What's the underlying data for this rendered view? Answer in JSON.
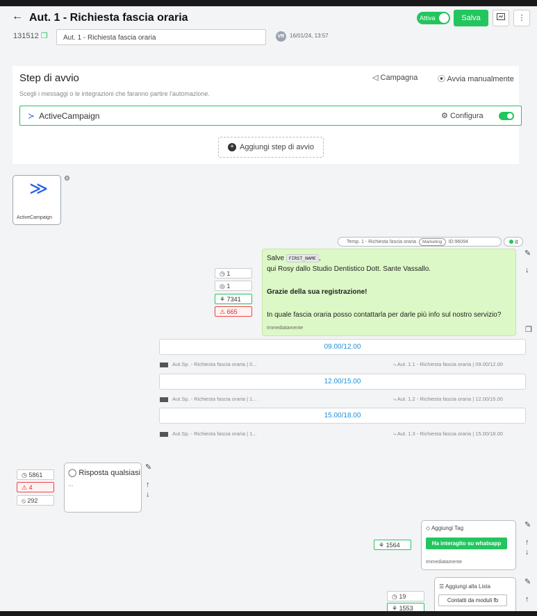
{
  "header": {
    "back_icon": "←",
    "title": "Aut. 1 - Richiesta fascia oraria",
    "active_label": "Attiva",
    "save_label": "Salva",
    "preview_icon": "preview-icon",
    "more_icon": "⋮",
    "auto_id": "131512",
    "name_value": "Aut. 1 - Richiesta fascia oraria",
    "user_initials": "VR",
    "datetime": "16/01/24, 13:57"
  },
  "start_step": {
    "title": "Step di avvio",
    "subtitle": "Scegli i messaggi o le integrazioni che faranno partire l'automazione.",
    "campaign_label": "Campagna",
    "manual_label": "Avvia manualmente",
    "trigger_name": "ActiveCampaign",
    "configure_label": "Configura",
    "add_step_label": "Aggiungi step di avvio"
  },
  "flow": {
    "trigger_node_label": "ActiveCampaign",
    "template": {
      "name": "Temp. 1 - Richiesta fascia oraria",
      "category": "Marketing",
      "id": "ID:96094",
      "lang": "it"
    },
    "message": {
      "greeting": "Salve",
      "variable": "FIRST_NAME",
      "greeting_end": ",",
      "line2": "qui Rosy dallo Studio Dentistico Dott. Sante Vassallo.",
      "line3": "Grazie della sua registrazione!",
      "line4": "In quale fascia oraria posso contattarla per darle più info sul nostro servizio?",
      "timing": "Immediatamente"
    },
    "message_stats": [
      "1",
      "1",
      "7341",
      "665"
    ],
    "options": [
      {
        "label": "09.00/12.00",
        "left": "Aut.Sp. - Richiesta fascia oraria | 0...",
        "right": "Aut. 1.1 - Richiesta fascia oraria | 09.00/12.00"
      },
      {
        "label": "12.00/15.00",
        "left": "Aut.Sp. - Richiesta fascia oraria | 1...",
        "right": "Aut. 1.2 - Richiesta fascia oraria | 12.00/15.00"
      },
      {
        "label": "15.00/18.00",
        "left": "Aut.Sp. - Richiesta fascia oraria | 1...",
        "right": "Aut. 1.3 - Richiesta fascia oraria | 15.00/18.00"
      }
    ],
    "response": {
      "label": "Risposta qualsiasi",
      "ellipsis": "...",
      "stats": [
        "5861",
        "4",
        "292"
      ]
    },
    "tag_step": {
      "title": "Aggiungi Tag",
      "tag": "Ha interagito su whatsapp",
      "timing": "Immediatamente",
      "stat": "1564"
    },
    "list_step": {
      "title": "Aggiungi alla Lista",
      "list": "Contatti da moduli fb",
      "stats": [
        "19",
        "1553"
      ]
    }
  },
  "colors": {
    "accent": "#22c55e",
    "link": "#1d8fd8",
    "error": "#ef4444",
    "message_bg": "#dcf8c6",
    "trigger_icon": "#2563eb"
  }
}
